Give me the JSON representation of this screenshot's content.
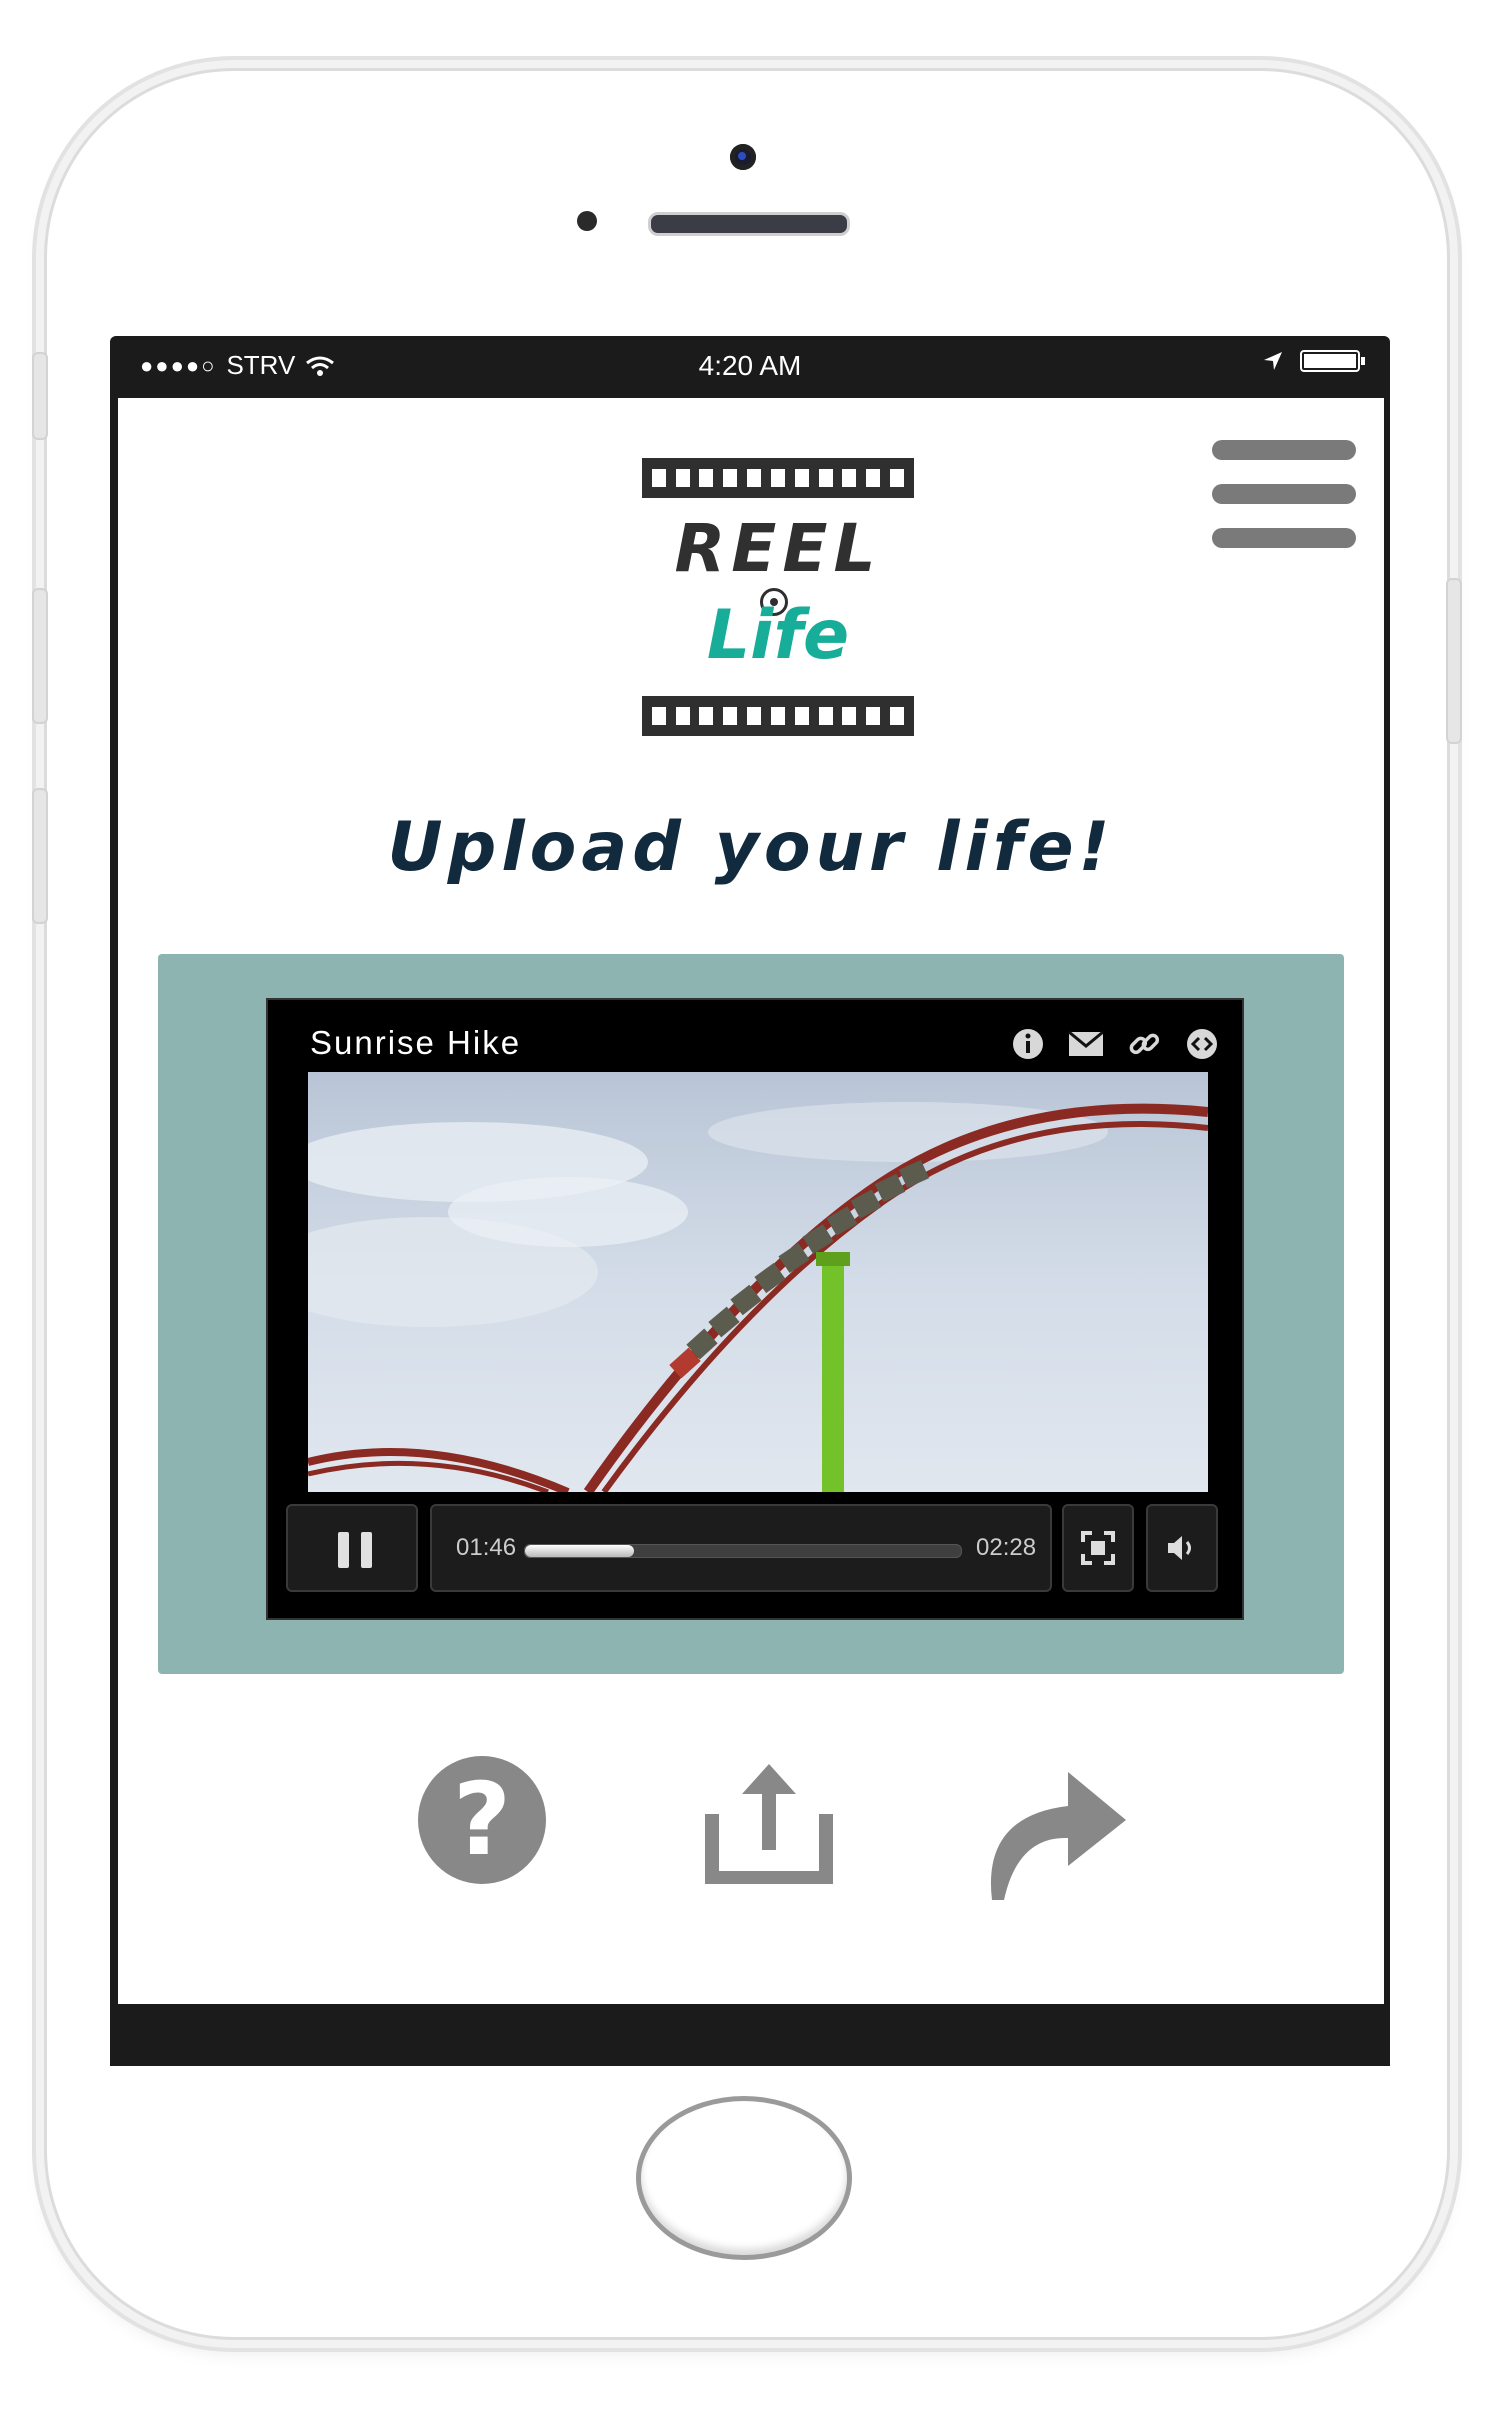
{
  "status_bar": {
    "carrier": "STRV",
    "time": "4:20 AM"
  },
  "app": {
    "logo_word_1": "REEL",
    "logo_word_2": "Life",
    "tagline": "Upload your life!"
  },
  "video": {
    "title": "Sunrise Hike",
    "elapsed": "01:46",
    "duration": "02:28",
    "progress_fraction": 0.25
  },
  "colors": {
    "panel_bg": "#8db4b0",
    "logo_accent": "#17ad99",
    "tagline_color": "#122a3d",
    "icon_gray": "#888888"
  },
  "icons": {
    "video_actions": [
      "info-icon",
      "email-icon",
      "link-icon",
      "embed-icon"
    ],
    "bottom_actions": [
      "help-icon",
      "upload-icon",
      "share-icon"
    ]
  }
}
